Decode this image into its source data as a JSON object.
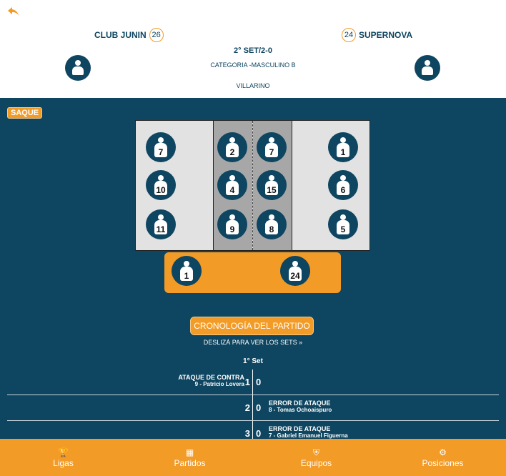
{
  "header": {
    "home": {
      "name": "CLUB JUNIN",
      "score": "26"
    },
    "away": {
      "name": "SUPERNOVA",
      "score": "24"
    },
    "set_status": "2° SET/2-0",
    "category": "CATEGORIA -MASCULINO B",
    "venue": "VILLARINO"
  },
  "serve_label": "SAQUE",
  "court": {
    "home_back": [
      "7",
      "10",
      "11"
    ],
    "home_front": [
      "2",
      "4",
      "9"
    ],
    "away_front": [
      "7",
      "15",
      "8"
    ],
    "away_back": [
      "1",
      "6",
      "5"
    ]
  },
  "bench": {
    "left": "1",
    "right": "24"
  },
  "timeline": {
    "button": "CRONOLOGÍA DEL PARTIDO",
    "hint": "DESLIZÁ PARA VER LOS SETS »",
    "set_title": "1° Set",
    "rows": [
      {
        "left_action": "ATAQUE DE CONTRA",
        "left_player": "9 - Patricio Lovera",
        "home": "1",
        "away": "0",
        "right_action": "",
        "right_player": ""
      },
      {
        "left_action": "",
        "left_player": "",
        "home": "2",
        "away": "0",
        "right_action": "ERROR DE ATAQUE",
        "right_player": "8 - Tomas Ochoaispuro"
      },
      {
        "left_action": "",
        "left_player": "",
        "home": "3",
        "away": "0",
        "right_action": "ERROR DE ATAQUE",
        "right_player": "7 - Gabriel Emanuel Figuerna"
      }
    ]
  },
  "nav": {
    "items": [
      {
        "label": "Ligas",
        "icon": "trophy-icon"
      },
      {
        "label": "Partidos",
        "icon": "calendar-icon"
      },
      {
        "label": "Equipos",
        "icon": "shield-icon"
      },
      {
        "label": "Posiciones",
        "icon": "medal-icon"
      }
    ]
  },
  "colors": {
    "accent": "#f29b26",
    "primary": "#0e4560",
    "court": "#e2e2e2",
    "net_zone": "#a7a7a7"
  }
}
